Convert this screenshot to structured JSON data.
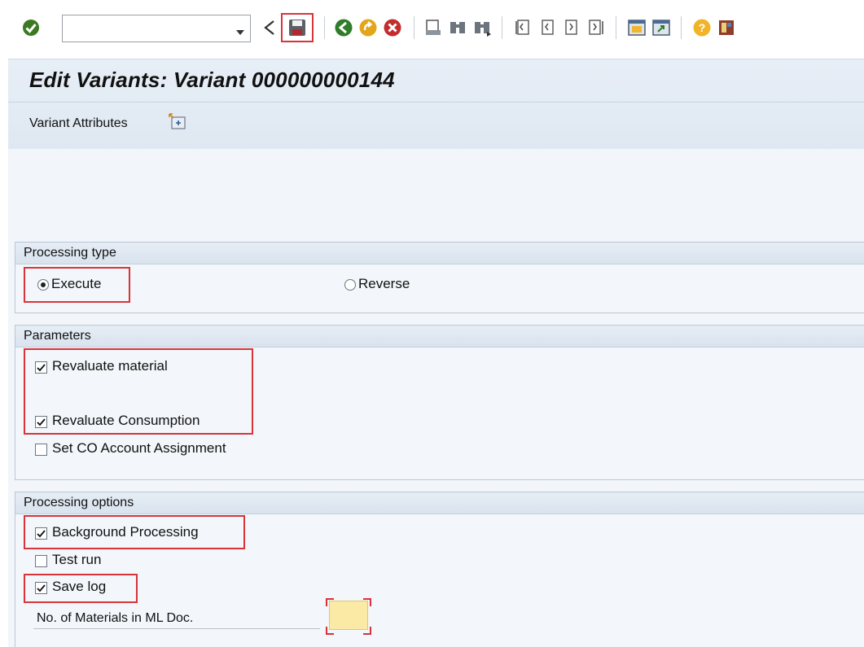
{
  "toolbar": {
    "command_field": {
      "value": "",
      "placeholder": ""
    },
    "buttons": [
      "enter-icon",
      "back-arrow-icon",
      "save-icon",
      "back-icon",
      "exit-icon",
      "cancel-icon",
      "print-icon",
      "find-icon",
      "find-next-icon",
      "first-page-icon",
      "previous-page-icon",
      "next-page-icon",
      "last-page-icon",
      "new-session-icon",
      "create-shortcut-icon",
      "help-icon",
      "customize-layout-icon"
    ]
  },
  "header": {
    "title": "Edit Variants: Variant 000000000144",
    "variant_attributes_label": "Variant Attributes"
  },
  "processing_type": {
    "title": "Processing type",
    "options": [
      {
        "label": "Execute",
        "selected": true
      },
      {
        "label": "Reverse",
        "selected": false
      }
    ]
  },
  "parameters": {
    "title": "Parameters",
    "items": [
      {
        "label": "Revaluate material",
        "checked": true
      },
      {
        "label": "Revaluate Consumption",
        "checked": true
      },
      {
        "label": "Set CO Account Assignment",
        "checked": false
      }
    ]
  },
  "processing_options": {
    "title": "Processing options",
    "items": [
      {
        "label": "Background Processing",
        "checked": true
      },
      {
        "label": "Test run",
        "checked": false
      },
      {
        "label": "Save log",
        "checked": true
      }
    ],
    "materials_field": {
      "label": "No. of Materials in ML Doc.",
      "value": ""
    }
  },
  "colors": {
    "highlight": "#d8343a",
    "group_background": "#f3f6fa",
    "header_background": "#e3ebf4",
    "input_yellow": "#fbeaa5"
  }
}
